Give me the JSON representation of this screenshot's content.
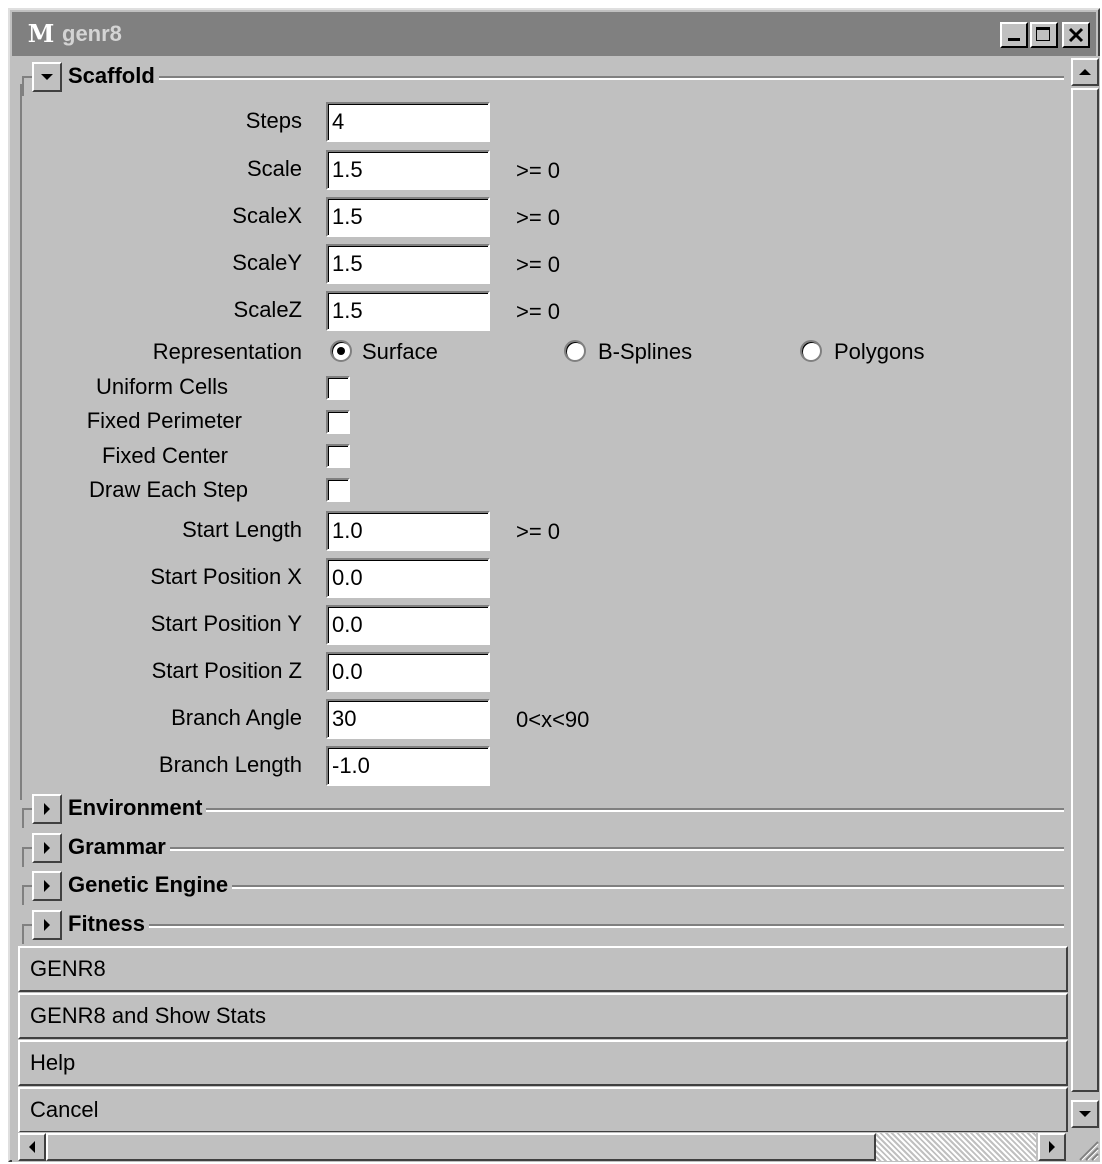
{
  "window": {
    "title": "genr8",
    "logo_text": "M",
    "controls": {
      "minimize": "minimize-icon",
      "maximize": "maximize-icon",
      "close": "close-icon"
    }
  },
  "scaffold": {
    "title": "Scaffold",
    "fields": {
      "steps": {
        "label": "Steps",
        "value": "4"
      },
      "scale": {
        "label": "Scale",
        "value": "1.5",
        "hint": ">= 0"
      },
      "scalex": {
        "label": "ScaleX",
        "value": "1.5",
        "hint": ">= 0"
      },
      "scaley": {
        "label": "ScaleY",
        "value": "1.5",
        "hint": ">= 0"
      },
      "scalez": {
        "label": "ScaleZ",
        "value": "1.5",
        "hint": ">= 0"
      },
      "start_length": {
        "label": "Start Length",
        "value": "1.0",
        "hint": ">= 0"
      },
      "start_pos_x": {
        "label": "Start Position X",
        "value": "0.0"
      },
      "start_pos_y": {
        "label": "Start Position Y",
        "value": "0.0"
      },
      "start_pos_z": {
        "label": "Start Position Z",
        "value": "0.0"
      },
      "branch_angle": {
        "label": "Branch Angle",
        "value": "30",
        "hint": "0<x<90"
      },
      "branch_length": {
        "label": "Branch Length",
        "value": "-1.0"
      }
    },
    "representation": {
      "label": "Representation",
      "options": [
        "Surface",
        "B-Splines",
        "Polygons"
      ],
      "selected": "Surface"
    },
    "checkboxes": {
      "uniform_cells": {
        "label": "Uniform Cells",
        "checked": false
      },
      "fixed_perimeter": {
        "label": "Fixed Perimeter",
        "checked": false
      },
      "fixed_center": {
        "label": "Fixed Center",
        "checked": false
      },
      "draw_each_step": {
        "label": "Draw Each Step",
        "checked": false
      }
    }
  },
  "sections": {
    "environment": "Environment",
    "grammar": "Grammar",
    "genetic_engine": "Genetic Engine",
    "fitness": "Fitness"
  },
  "buttons": {
    "genr8": "GENR8",
    "genr8_stats": "GENR8 and Show Stats",
    "help": "Help",
    "cancel": "Cancel"
  }
}
